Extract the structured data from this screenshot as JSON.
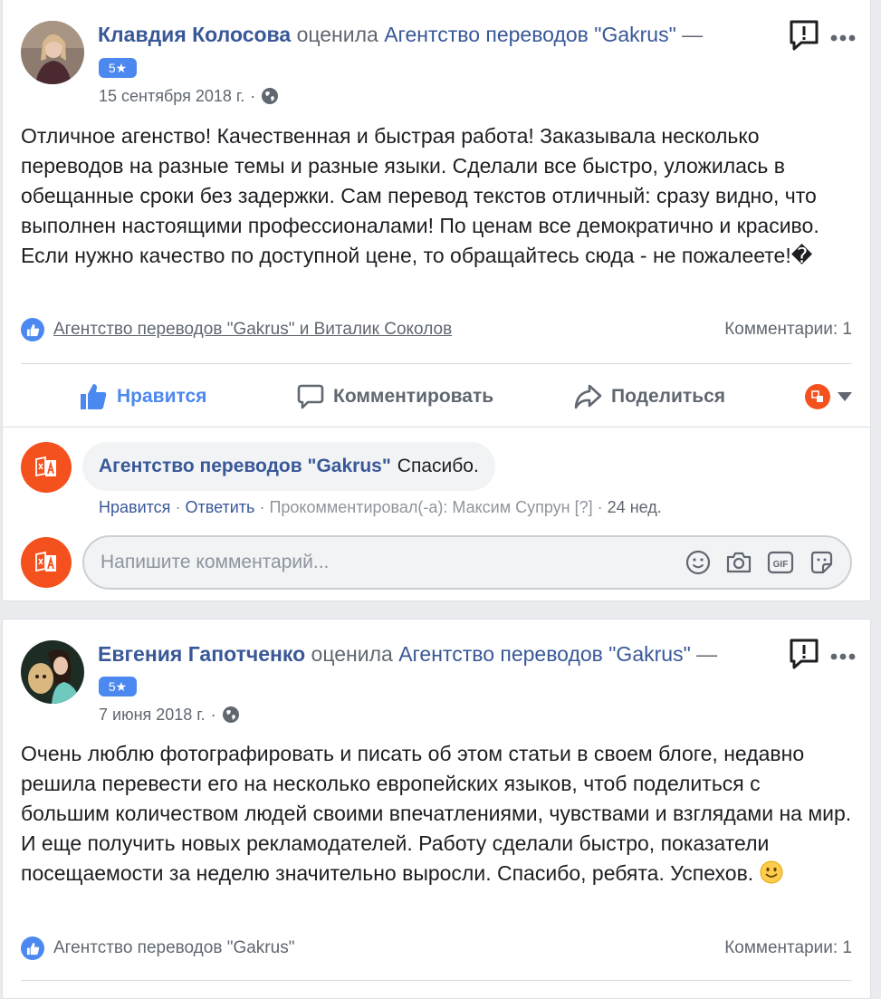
{
  "reviews": [
    {
      "author": "Клавдия Колосова",
      "verb": "оценила",
      "page": "Агентство переводов \"Gakrus\"",
      "dash": "—",
      "rating": "5★",
      "date": "15 сентября 2018 г.",
      "date_sep": "·",
      "text": "Отличное агенство! Качественная и быстрая работа! Заказывала несколько переводов на разные темы и разные языки. Сделали все быстро, уложилась в обещанные сроки без задержки. Сам перевод текстов отличный: сразу видно, что выполнен настоящими профессионалами! По ценам все демократично и красиво. Если нужно качество по доступной цене, то обращайтесь сюда - не пожалеете!�",
      "likers": "Агентство переводов \"Gakrus\" и Виталик Соколов",
      "comments_count": "Комментарии: 1"
    },
    {
      "author": "Евгения Гапотченко",
      "verb": "оценила",
      "page": "Агентство переводов \"Gakrus\"",
      "dash": "—",
      "rating": "5★",
      "date": "7 июня 2018 г.",
      "date_sep": "·",
      "text": "Очень люблю фотографировать и писать об этом статьи в своем блоге, недавно решила перевести его на несколько европейских языков, чтоб поделиться с большим количеством людей своими впечатлениями, чувствами и взглядами на мир. И еще получить новых рекламодателей. Работу сделали быстро, показатели посещаемости за неделю значительно выросли. Спасибо, ребята. Успехов.",
      "likers": "Агентство переводов \"Gakrus\"",
      "comments_count": "Комментарии: 1"
    }
  ],
  "actions": {
    "like": "Нравится",
    "comment": "Комментировать",
    "share": "Поделиться"
  },
  "reply": {
    "author": "Агентство переводов \"Gakrus\"",
    "text": "Спасибо.",
    "like": "Нравится",
    "answer": "Ответить",
    "commented_by": "Прокомментировал(-а): Максим Супрун",
    "help": "[?]",
    "age": "24 нед.",
    "sep": "·"
  },
  "compose": {
    "placeholder": "Напишите комментарий..."
  },
  "colors": {
    "link": "#385898",
    "like_blue": "#4b88ef",
    "brand_orange": "#f4511e",
    "text": "#1c1e21",
    "muted": "#606770"
  }
}
